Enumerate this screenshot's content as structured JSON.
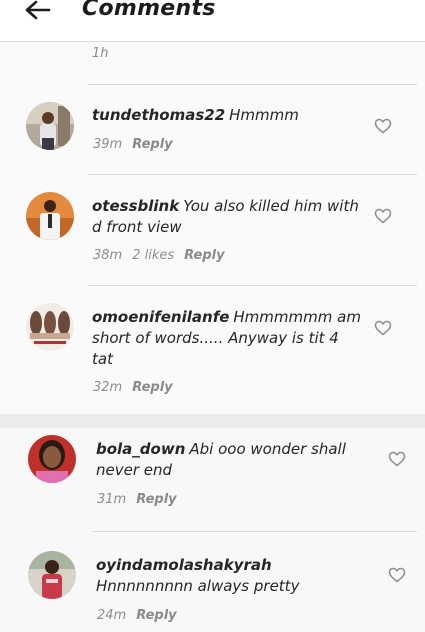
{
  "header": {
    "title": "Comments"
  },
  "first_time": "1h",
  "comments": [
    {
      "username": "tundethomas22",
      "text": "Hmmmm",
      "time": "39m",
      "likes": "",
      "reply": "Reply"
    },
    {
      "username": "otessblink",
      "text": "You also killed him with d front view",
      "time": "38m",
      "likes": "2 likes",
      "reply": "Reply"
    },
    {
      "username": "omoenifenilanfe",
      "text": "Hmmmmmm am short of words..... Anyway is tit 4 tat",
      "time": "32m",
      "likes": "",
      "reply": "Reply"
    },
    {
      "username": "bola_down",
      "text": "Abi ooo wonder shall never end",
      "time": "31m",
      "likes": "",
      "reply": "Reply"
    },
    {
      "username": "oyindamolashakyrah",
      "text": "Hnnnnnnnnn always pretty",
      "time": "24m",
      "likes": "",
      "reply": "Reply"
    }
  ],
  "icons": {
    "back": "back-arrow-icon",
    "like": "heart-outline-icon"
  },
  "colors": {
    "header_bg": "#ffffff",
    "panel_bg": "#fafafa",
    "gap_bg": "#ececec",
    "meta_text": "#8e8e8e"
  }
}
